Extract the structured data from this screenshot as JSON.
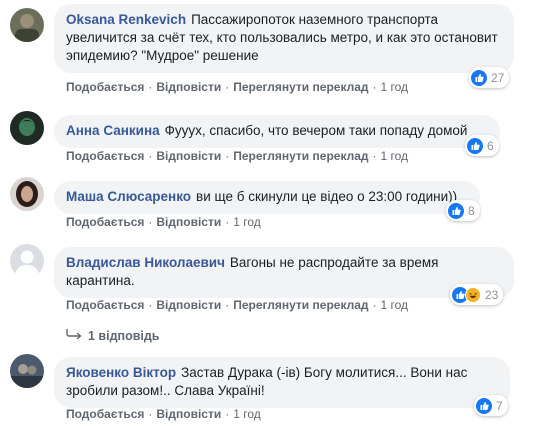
{
  "comments": [
    {
      "author": "Oksana Renkevich",
      "text": "Пассажиропоток наземного транспорта увеличится за счёт тех, кто пользовались метро, и как это остановит эпидемию? \"Мудрое\" решение",
      "like_label": "Подобається",
      "reply_label": "Відповісти",
      "translate_label": "Переглянути переклад",
      "time": "1 год",
      "reaction_count": "27"
    },
    {
      "author": "Анна Санкина",
      "text": "Фууух, спасибо, что вечером таки попаду домой",
      "like_label": "Подобається",
      "reply_label": "Відповісти",
      "translate_label": "Переглянути переклад",
      "time": "1 год",
      "reaction_count": "6"
    },
    {
      "author": "Маша Слюсаренко",
      "text": "ви ще б скинули це відео о 23:00 години))",
      "like_label": "Подобається",
      "reply_label": "Відповісти",
      "time": "1 год",
      "reaction_count": "8"
    },
    {
      "author": "Владислав Николаевич",
      "text": "Вагоны не распродайте за время карантина.",
      "like_label": "Подобається",
      "reply_label": "Відповісти",
      "translate_label": "Переглянути переклад",
      "time": "1 год",
      "reaction_count": "23",
      "replies_label": "1 відповідь"
    },
    {
      "author": "Яковенко Віктор",
      "text": "Застав Дурака (-ів) Богу молитися... Вони нас зробили разом!.. Слава Україні!",
      "like_label": "Подобається",
      "reply_label": "Відповісти",
      "time": "1 год",
      "reaction_count": "7"
    }
  ],
  "colors": {
    "author": "#385898",
    "bubble": "#f2f3f5",
    "meta": "#606770",
    "like": "#1877f2",
    "haha": "#f7b125"
  }
}
